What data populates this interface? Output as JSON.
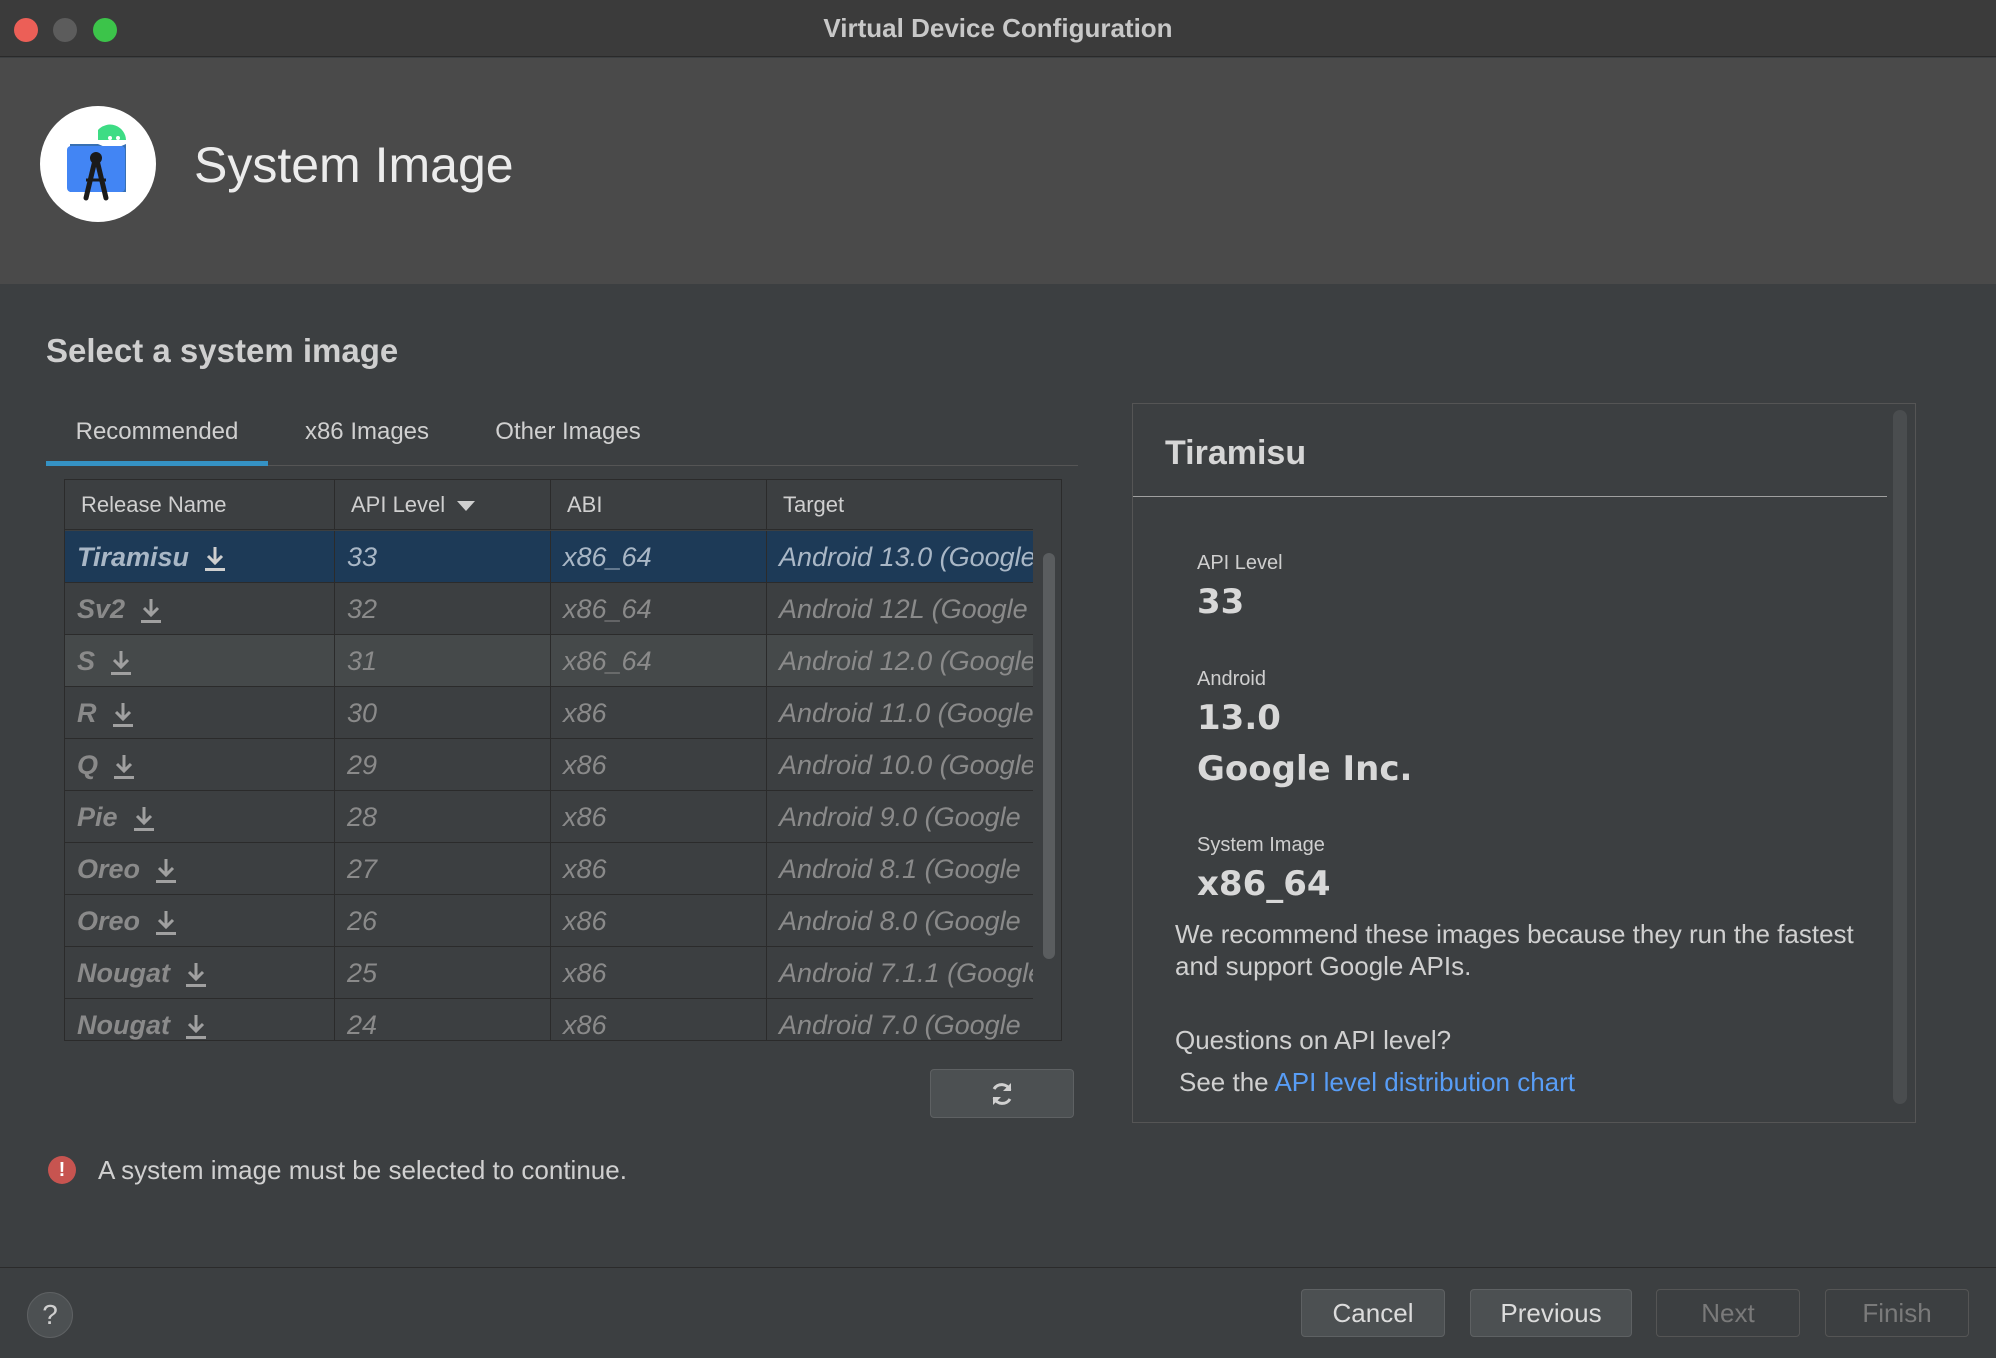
{
  "window": {
    "title": "Virtual Device Configuration",
    "controls": [
      "close-icon",
      "minimize-icon",
      "maximize-icon"
    ]
  },
  "header": {
    "title": "System Image",
    "logo_icon": "android-studio-icon"
  },
  "main": {
    "section_title": "Select a system image",
    "tabs": [
      {
        "label": "Recommended",
        "active": true
      },
      {
        "label": "x86 Images",
        "active": false
      },
      {
        "label": "Other Images",
        "active": false
      }
    ],
    "table": {
      "columns": [
        "Release Name",
        "API Level",
        "ABI",
        "Target"
      ],
      "sort_column": "API Level",
      "sort_direction": "descending",
      "rows": [
        {
          "name": "Tiramisu",
          "api": "33",
          "abi": "x86_64",
          "target": "Android 13.0 (Google",
          "selected": true
        },
        {
          "name": "Sv2",
          "api": "32",
          "abi": "x86_64",
          "target": "Android 12L (Google"
        },
        {
          "name": "S",
          "api": "31",
          "abi": "x86_64",
          "target": "Android 12.0 (Google"
        },
        {
          "name": "R",
          "api": "30",
          "abi": "x86",
          "target": "Android 11.0 (Google"
        },
        {
          "name": "Q",
          "api": "29",
          "abi": "x86",
          "target": "Android 10.0 (Google"
        },
        {
          "name": "Pie",
          "api": "28",
          "abi": "x86",
          "target": "Android 9.0 (Google"
        },
        {
          "name": "Oreo",
          "api": "27",
          "abi": "x86",
          "target": "Android 8.1 (Google"
        },
        {
          "name": "Oreo",
          "api": "26",
          "abi": "x86",
          "target": "Android 8.0 (Google"
        },
        {
          "name": "Nougat",
          "api": "25",
          "abi": "x86",
          "target": "Android 7.1.1 (Google"
        },
        {
          "name": "Nougat",
          "api": "24",
          "abi": "x86",
          "target": "Android 7.0 (Google"
        }
      ]
    },
    "refresh_icon": "refresh-icon"
  },
  "details": {
    "title": "Tiramisu",
    "api_label": "API Level",
    "api_value": "33",
    "android_label": "Android",
    "android_value": "13.0",
    "vendor": "Google Inc.",
    "image_label": "System Image",
    "image_value": "x86_64",
    "recommend_text": "We recommend these images because they run the fastest and support Google APIs.",
    "question": "Questions on API level?",
    "see_the": "See the",
    "link_text": "API level distribution chart"
  },
  "status": {
    "error_icon": "error-icon",
    "error_glyph": "!",
    "message": "A system image must be selected to continue."
  },
  "footer": {
    "help": "?",
    "cancel": "Cancel",
    "previous": "Previous",
    "next": "Next",
    "finish": "Finish"
  },
  "colors": {
    "background": "#3c3f41",
    "header": "#4a4a4a",
    "selection": "#1d3a57",
    "accent": "#3592c4",
    "link": "#589df6",
    "error": "#c75450"
  }
}
